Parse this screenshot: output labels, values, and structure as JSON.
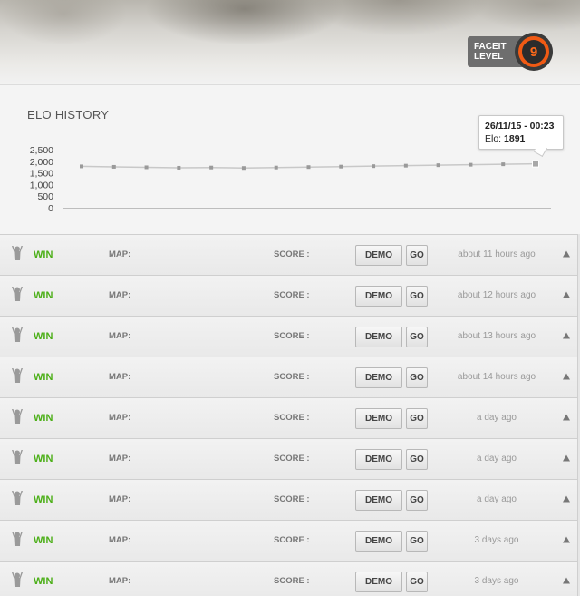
{
  "header": {
    "faceit_label": "FACEIT",
    "level_label": "LEVEL",
    "level_value": "9",
    "accent_color": "#f05a14"
  },
  "elo": {
    "title": "ELO HISTORY",
    "tooltip": {
      "date": "26/11/15 - 00:23",
      "elo_prefix": "Elo:",
      "elo_value": "1891"
    }
  },
  "chart_data": {
    "type": "line",
    "title": "ELO HISTORY",
    "xlabel": "",
    "ylabel": "",
    "ylim": [
      0,
      2500
    ],
    "yticks": [
      0,
      500,
      1000,
      1500,
      2000,
      2500
    ],
    "ytick_labels": [
      "0",
      "500",
      "1,000",
      "1,500",
      "2,000",
      "2,500"
    ],
    "grid": false,
    "series": [
      {
        "values": [
          1780,
          1760,
          1740,
          1720,
          1730,
          1710,
          1730,
          1750,
          1770,
          1790,
          1810,
          1830,
          1850,
          1870,
          1891
        ]
      }
    ],
    "line_color": "#c8c8c8",
    "point_color": "#9a9a9a"
  },
  "matches": {
    "map_label": "MAP:",
    "score_label": "SCORE :",
    "demo_label": "DEMO",
    "go_label": "GO",
    "win_color": "#4caf18",
    "rows": [
      {
        "result": "WIN",
        "time": "about 11 hours ago"
      },
      {
        "result": "WIN",
        "time": "about 12 hours ago"
      },
      {
        "result": "WIN",
        "time": "about 13 hours ago"
      },
      {
        "result": "WIN",
        "time": "about 14 hours ago"
      },
      {
        "result": "WIN",
        "time": "a day ago"
      },
      {
        "result": "WIN",
        "time": "a day ago"
      },
      {
        "result": "WIN",
        "time": "a day ago"
      },
      {
        "result": "WIN",
        "time": "3 days ago"
      },
      {
        "result": "WIN",
        "time": "3 days ago"
      }
    ]
  }
}
